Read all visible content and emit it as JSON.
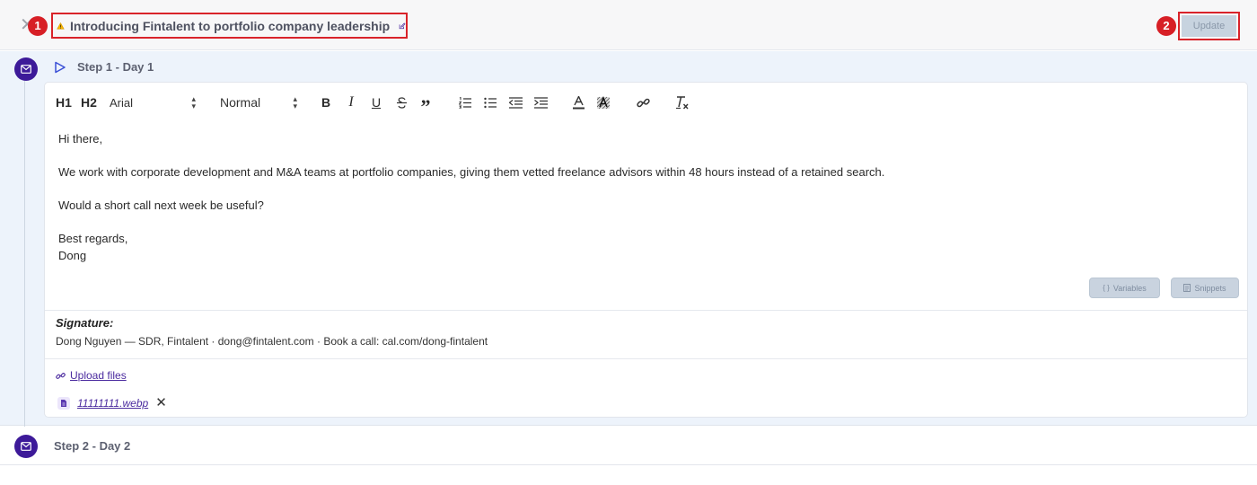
{
  "header": {
    "close_symbol": "✕",
    "title": "Introducing Fintalent to portfolio company leadership",
    "title_icon": "warning-icon",
    "edit_icon": "edit-icon",
    "update_label": "Update",
    "callout_1": "1",
    "callout_2": "2"
  },
  "steps": [
    {
      "label": "Step 1 - Day 1",
      "icon": "mail-icon",
      "expanded": true
    },
    {
      "label": "Step 2 - Day 2",
      "icon": "mail-icon",
      "expanded": false
    }
  ],
  "toolbar": {
    "h1": "H1",
    "h2": "H2",
    "font": "Arial",
    "size": "Normal",
    "bold": "B",
    "italic": "I",
    "underline": "U",
    "quote": "”"
  },
  "email": {
    "greeting": "Hi there,",
    "paragraph1": "We work with corporate development and M&A teams at portfolio companies, giving them vetted freelance advisors within 48 hours instead of a retained search.",
    "paragraph2": "Would a short call next week be useful?",
    "closing": "Best regards,",
    "name": "Dong"
  },
  "buttons": {
    "variables": "Variables",
    "snippets": "Snippets"
  },
  "signature": {
    "title": "Signature:",
    "text": "Dong Nguyen — SDR, Fintalent · dong@fintalent.com · Book a call: cal.com/dong-fintalent"
  },
  "attachments": {
    "upload_label": "Upload files",
    "files": [
      {
        "name": "11111111.webp"
      }
    ]
  },
  "colors": {
    "accent": "#3d1a99",
    "callout": "#d71f26",
    "link": "#4b2b9f",
    "step_bg": "#edf3fb"
  }
}
